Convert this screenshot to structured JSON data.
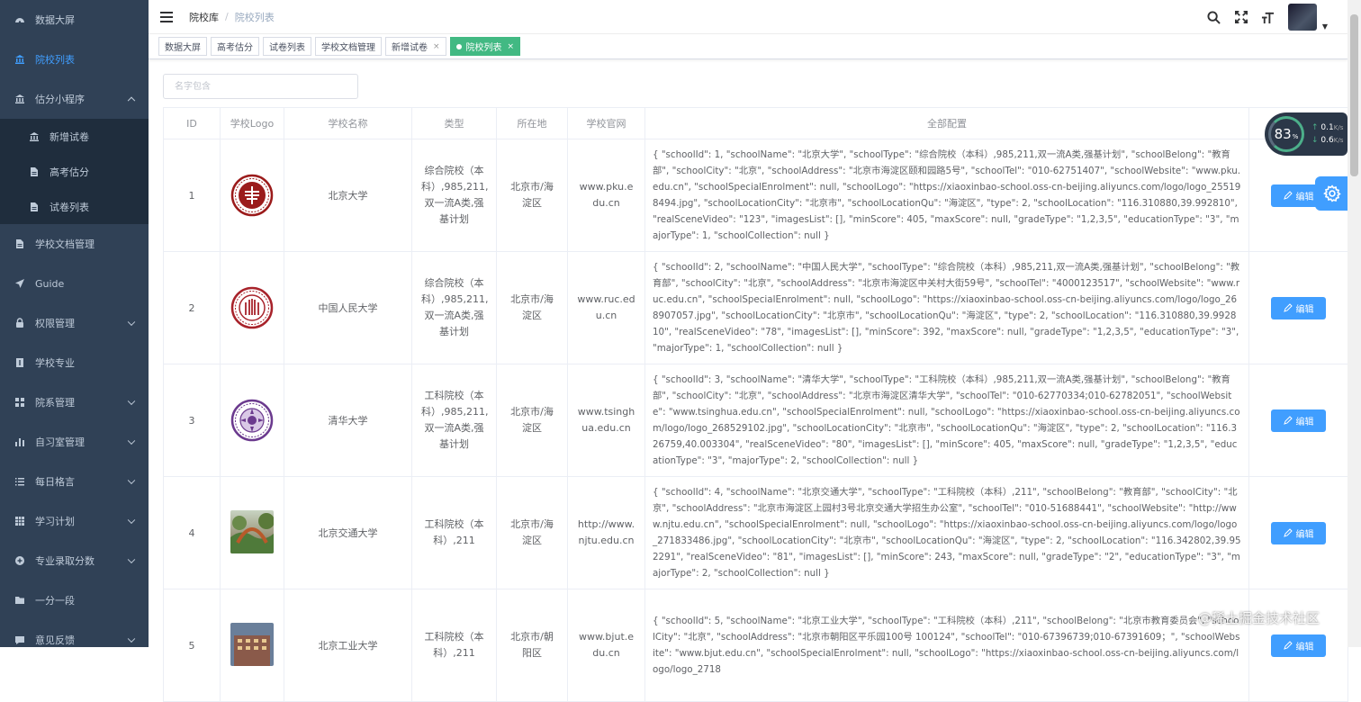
{
  "sidebar": {
    "items": [
      {
        "label": "数据大屏",
        "icon": "dashboard-icon"
      },
      {
        "label": "院校列表",
        "icon": "school-icon",
        "active": true
      },
      {
        "label": "估分小程序",
        "icon": "school-icon",
        "expanded": true
      },
      {
        "label": "学校文档管理",
        "icon": "document-icon"
      },
      {
        "label": "Guide",
        "icon": "send-icon"
      },
      {
        "label": "权限管理",
        "icon": "lock-icon",
        "has_arrow": true
      },
      {
        "label": "学校专业",
        "icon": "book-icon"
      },
      {
        "label": "院系管理",
        "icon": "grid-icon",
        "has_arrow": true
      },
      {
        "label": "自习室管理",
        "icon": "chart-icon",
        "has_arrow": true
      },
      {
        "label": "每日格言",
        "icon": "list-icon",
        "has_arrow": true
      },
      {
        "label": "学习计划",
        "icon": "table-icon",
        "has_arrow": true
      },
      {
        "label": "专业录取分数",
        "icon": "plus-circle-icon",
        "has_arrow": true
      },
      {
        "label": "一分一段",
        "icon": "folder-icon"
      },
      {
        "label": "意见反馈",
        "icon": "feedback-icon",
        "has_arrow": true
      }
    ],
    "sub_items": [
      {
        "label": "新增试卷",
        "icon": "school-icon"
      },
      {
        "label": "高考估分",
        "icon": "document-icon"
      },
      {
        "label": "试卷列表",
        "icon": "document-icon"
      }
    ]
  },
  "breadcrumb": {
    "root": "院校库",
    "sep": "/",
    "current": "院校列表"
  },
  "tags": [
    {
      "label": "数据大屏",
      "closable": false
    },
    {
      "label": "高考估分",
      "closable": false
    },
    {
      "label": "试卷列表",
      "closable": false
    },
    {
      "label": "学校文档管理",
      "closable": false
    },
    {
      "label": "新增试卷",
      "closable": true
    },
    {
      "label": "院校列表",
      "closable": true,
      "active": true
    }
  ],
  "search": {
    "placeholder": "名字包含"
  },
  "table": {
    "headers": [
      "ID",
      "学校Logo",
      "学校名称",
      "类型",
      "所在地",
      "学校官网",
      "全部配置",
      ""
    ],
    "edit_label": "编辑",
    "rows": [
      {
        "id": "1",
        "name": "北京大学",
        "type": "综合院校（本科）,985,211,双一流A类,强基计划",
        "loc": "北京市/海淀区",
        "site": "www.pku.edu.cn",
        "logo": "pku",
        "cfg": "{ \"schoolId\": 1, \"schoolName\": \"北京大学\", \"schoolType\": \"综合院校（本科）,985,211,双一流A类,强基计划\", \"schoolBelong\": \"教育部\", \"schoolCity\": \"北京\", \"schoolAddress\": \"北京市海淀区颐和园路5号\", \"schoolTel\": \"010-62751407\", \"schoolWebsite\": \"www.pku.edu.cn\", \"schoolSpecialEnrolment\": null, \"schoolLogo\": \"https://xiaoxinbao-school.oss-cn-beijing.aliyuncs.com/logo/logo_255198494.jpg\", \"schoolLocationCity\": \"北京市\", \"schoolLocationQu\": \"海淀区\", \"type\": 2, \"schoolLocation\": \"116.310880,39.992810\", \"realSceneVideo\": \"123\", \"imagesList\": [], \"minScore\": 405, \"maxScore\": null, \"gradeType\": \"1,2,3,5\", \"educationType\": \"3\", \"majorType\": 1, \"schoolCollection\": null }"
      },
      {
        "id": "2",
        "name": "中国人民大学",
        "type": "综合院校（本科）,985,211,双一流A类,强基计划",
        "loc": "北京市/海淀区",
        "site": "www.ruc.edu.cn",
        "logo": "ruc",
        "cfg": "{ \"schoolId\": 2, \"schoolName\": \"中国人民大学\", \"schoolType\": \"综合院校（本科）,985,211,双一流A类,强基计划\", \"schoolBelong\": \"教育部\", \"schoolCity\": \"北京\", \"schoolAddress\": \"北京市海淀区中关村大街59号\", \"schoolTel\": \"4000123517\", \"schoolWebsite\": \"www.ruc.edu.cn\", \"schoolSpecialEnrolment\": null, \"schoolLogo\": \"https://xiaoxinbao-school.oss-cn-beijing.aliyuncs.com/logo/logo_268907057.jpg\", \"schoolLocationCity\": \"北京市\", \"schoolLocationQu\": \"海淀区\", \"type\": 2, \"schoolLocation\": \"116.310880,39.992810\", \"realSceneVideo\": \"78\", \"imagesList\": [], \"minScore\": 392, \"maxScore\": null, \"gradeType\": \"1,2,3,5\", \"educationType\": \"3\", \"majorType\": 1, \"schoolCollection\": null }"
      },
      {
        "id": "3",
        "name": "清华大学",
        "type": "工科院校（本科）,985,211,双一流A类,强基计划",
        "loc": "北京市/海淀区",
        "site": "www.tsinghua.edu.cn",
        "logo": "thu",
        "cfg": "{ \"schoolId\": 3, \"schoolName\": \"清华大学\", \"schoolType\": \"工科院校（本科）,985,211,双一流A类,强基计划\", \"schoolBelong\": \"教育部\", \"schoolCity\": \"北京\", \"schoolAddress\": \"北京市海淀区清华大学\", \"schoolTel\": \"010-62770334;010-62782051\", \"schoolWebsite\": \"www.tsinghua.edu.cn\", \"schoolSpecialEnrolment\": null, \"schoolLogo\": \"https://xiaoxinbao-school.oss-cn-beijing.aliyuncs.com/logo/logo_268529102.jpg\", \"schoolLocationCity\": \"北京市\", \"schoolLocationQu\": \"海淀区\", \"type\": 2, \"schoolLocation\": \"116.326759,40.003304\", \"realSceneVideo\": \"80\", \"imagesList\": [], \"minScore\": 405, \"maxScore\": null, \"gradeType\": \"1,2,3,5\", \"educationType\": \"3\", \"majorType\": 2, \"schoolCollection\": null }"
      },
      {
        "id": "4",
        "name": "北京交通大学",
        "type": "工科院校（本科）,211",
        "loc": "北京市/海淀区",
        "site": "http://www.njtu.edu.cn",
        "logo": "photo-garden",
        "cfg": "{ \"schoolId\": 4, \"schoolName\": \"北京交通大学\", \"schoolType\": \"工科院校（本科）,211\", \"schoolBelong\": \"教育部\", \"schoolCity\": \"北京\", \"schoolAddress\": \"北京市海淀区上园村3号北京交通大学招生办公室\", \"schoolTel\": \"010-51688441\", \"schoolWebsite\": \"http://www.njtu.edu.cn\", \"schoolSpecialEnrolment\": null, \"schoolLogo\": \"https://xiaoxinbao-school.oss-cn-beijing.aliyuncs.com/logo/logo_271833486.jpg\", \"schoolLocationCity\": \"北京市\", \"schoolLocationQu\": \"海淀区\", \"type\": 2, \"schoolLocation\": \"116.342802,39.952291\", \"realSceneVideo\": \"81\", \"imagesList\": [], \"minScore\": 243, \"maxScore\": null, \"gradeType\": \"2\", \"educationType\": \"3\", \"majorType\": 2, \"schoolCollection\": null }"
      },
      {
        "id": "5",
        "name": "北京工业大学",
        "type": "工科院校（本科）,211",
        "loc": "北京市/朝阳区",
        "site": "www.bjut.edu.cn",
        "logo": "photo-building",
        "cfg": "{ \"schoolId\": 5, \"schoolName\": \"北京工业大学\", \"schoolType\": \"工科院校（本科）,211\", \"schoolBelong\": \"北京市教育委员会\", \"schoolCity\": \"北京\", \"schoolAddress\": \"北京市朝阳区平乐园100号 100124\", \"schoolTel\": \"010-67396739;010-67391609；\", \"schoolWebsite\": \"www.bjut.edu.cn\", \"schoolSpecialEnrolment\": null, \"schoolLogo\": \"https://xiaoxinbao-school.oss-cn-beijing.aliyuncs.com/logo/logo_2718"
      }
    ]
  },
  "speed_widget": {
    "percent": "83",
    "unit": "%",
    "up": "0.1",
    "down": "0.6",
    "rate_unit": "K/s"
  },
  "watermark": "@稀土掘金技术社区"
}
